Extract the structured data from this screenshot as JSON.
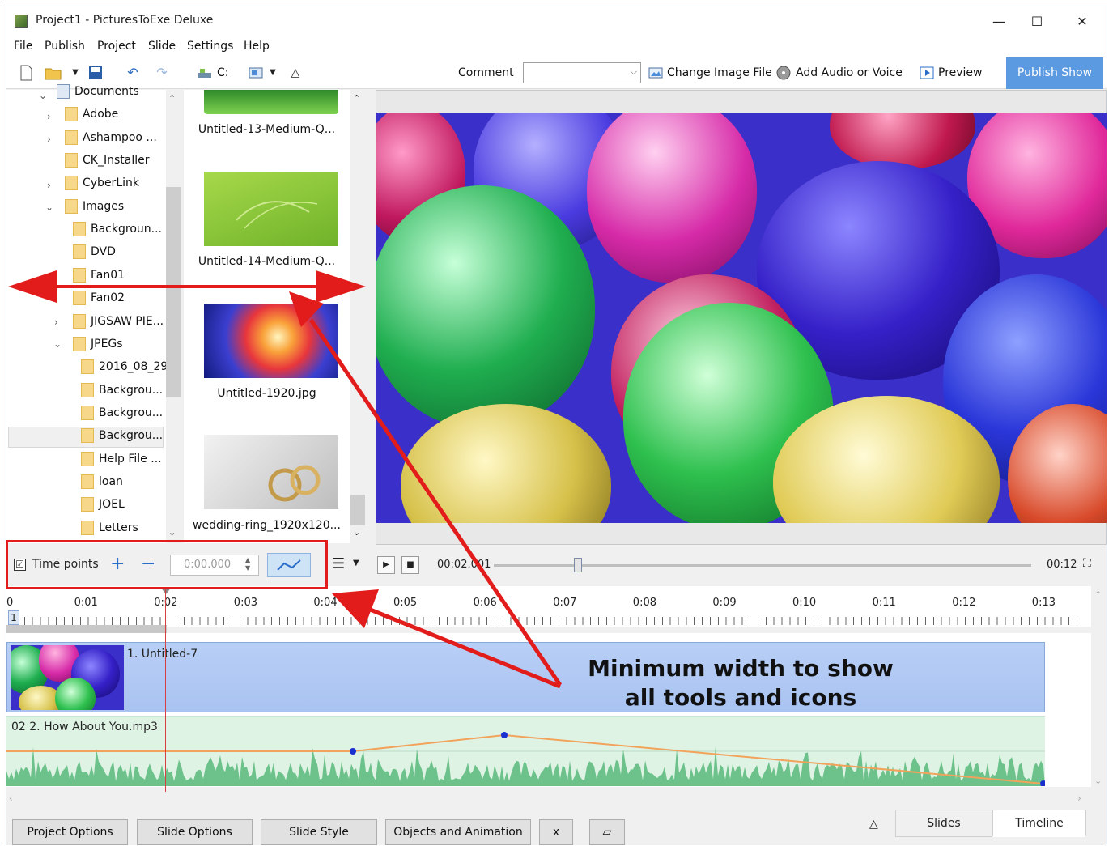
{
  "window": {
    "title": "Project1 - PicturesToExe Deluxe",
    "minimize": "—",
    "maximize": "☐",
    "close": "✕"
  },
  "menu": [
    "File",
    "Publish",
    "Project",
    "Slide",
    "Settings",
    "Help"
  ],
  "toolbar": {
    "drive_label": "C:",
    "comment_label": "Comment",
    "comment_value": "",
    "change_image": "Change Image File",
    "add_audio": "Add Audio or Voice",
    "preview": "Preview",
    "publish_show": "Publish Show"
  },
  "tree": {
    "items": [
      {
        "label": "Documents",
        "indent": 0
      },
      {
        "label": "Adobe",
        "indent": 1
      },
      {
        "label": "Ashampoo ...",
        "indent": 1
      },
      {
        "label": "CK_Installer",
        "indent": 1
      },
      {
        "label": "CyberLink",
        "indent": 1
      },
      {
        "label": "Images",
        "indent": 1
      },
      {
        "label": "Backgroun...",
        "indent": 2
      },
      {
        "label": "DVD",
        "indent": 2
      },
      {
        "label": "Fan01",
        "indent": 2
      },
      {
        "label": "Fan02",
        "indent": 2
      },
      {
        "label": "JIGSAW PIE...",
        "indent": 2
      },
      {
        "label": "JPEGs",
        "indent": 2
      },
      {
        "label": "2016_08_29",
        "indent": 3
      },
      {
        "label": "Backgrou...",
        "indent": 3
      },
      {
        "label": "Backgrou...",
        "indent": 3
      },
      {
        "label": "Backgrou...",
        "indent": 3
      },
      {
        "label": "Help File ...",
        "indent": 3
      },
      {
        "label": "loan",
        "indent": 3
      },
      {
        "label": "JOEL",
        "indent": 3
      },
      {
        "label": "Letters",
        "indent": 3
      }
    ]
  },
  "thumbnails": [
    {
      "label": "Untitled-13-Medium-Q..."
    },
    {
      "label": "Untitled-14-Medium-Q..."
    },
    {
      "label": "Untitled-1920.jpg"
    },
    {
      "label": "wedding-ring_1920x120..."
    }
  ],
  "timeline_controls": {
    "time_points_label": "Time points",
    "time_points_checked": "☑",
    "spin_value": "0:00.000",
    "current_time": "00:02.001",
    "total_time": "00:12",
    "slider_fraction": 0.167
  },
  "ruler": {
    "labels": [
      "0",
      "0:01",
      "0:02",
      "0:03",
      "0:04",
      "0:05",
      "0:06",
      "0:07",
      "0:08",
      "0:09",
      "0:10",
      "0:11",
      "0:12",
      "0:13"
    ],
    "slide_number": "1"
  },
  "tracks": {
    "slide_label": "1. Untitled-7",
    "audio_label": "02 2. How About You.mp3"
  },
  "annotation": {
    "line1": "Minimum width to show",
    "line2": "all tools and icons"
  },
  "bottom_buttons": [
    "Project Options",
    "Slide Options",
    "Slide Style",
    "Objects and Animation",
    "x"
  ],
  "tabs": {
    "slides": "Slides",
    "timeline": "Timeline"
  },
  "colors": {
    "publish_bg": "#5b9ae0",
    "annotation_red": "#e21b1b",
    "slide_track": "#b8cff6",
    "audio_track": "#dff3e5"
  }
}
